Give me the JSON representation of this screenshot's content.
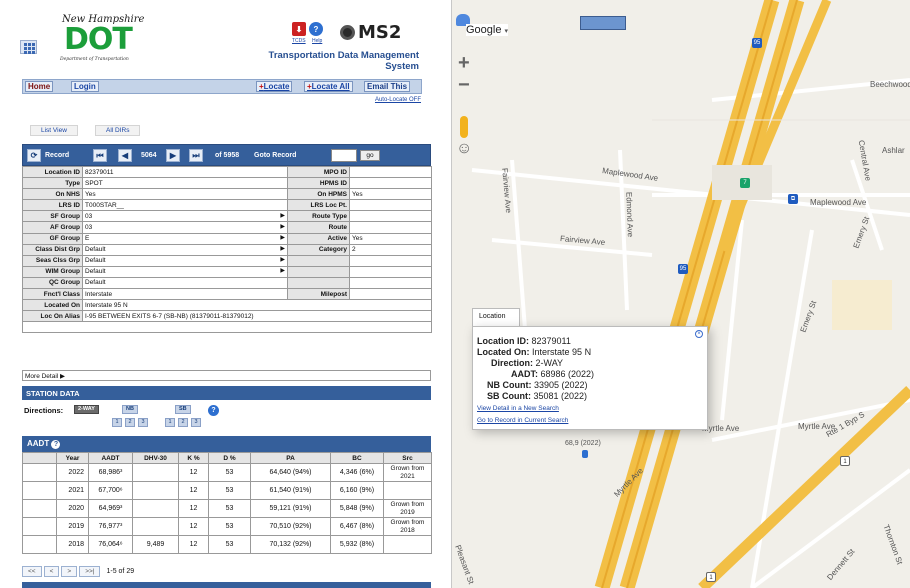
{
  "header": {
    "logo_script": "New Hampshire",
    "logo_main": "DOT",
    "logo_sub": "Department of Transportation",
    "tcds_label": "TCDS",
    "help_label": "Help",
    "brand": "MS2",
    "app_title_line1": "Transportation Data Management",
    "app_title_line2": "System"
  },
  "nav": {
    "home": "Home",
    "login": "Login",
    "locate": "Locate",
    "locate_all": "Locate All",
    "email": "Email This",
    "auto_locate": "Auto-Locate OFF"
  },
  "tabs": {
    "list_view": "List View",
    "all_dirs": "All DIRs"
  },
  "record_bar": {
    "record_label": "Record",
    "current": "5064",
    "of_total": "of 5958",
    "goto_label": "Goto Record",
    "go": "go"
  },
  "detail": {
    "location_id_label": "Location ID",
    "location_id": "82379011",
    "mpo_id_label": "MPO ID",
    "mpo_id": "",
    "type_label": "Type",
    "type": "SPOT",
    "hpms_id_label": "HPMS ID",
    "hpms_id": "",
    "on_nhs_label": "On NHS",
    "on_nhs": "Yes",
    "on_hpms_label": "On HPMS",
    "on_hpms": "Yes",
    "lrs_id_label": "LRS ID",
    "lrs_id": "T000STAR__",
    "lrs_loc_label": "LRS Loc Pt.",
    "lrs_loc": "",
    "sf_group_label": "SF Group",
    "sf_group": "03",
    "route_type_label": "Route Type",
    "route_type": "",
    "af_group_label": "AF Group",
    "af_group": "03",
    "route_label": "Route",
    "route": "",
    "gf_group_label": "GF Group",
    "gf_group": "E",
    "active_label": "Active",
    "active": "Yes",
    "class_dist_label": "Class Dist Grp",
    "class_dist": "Default",
    "category_label": "Category",
    "category": "2",
    "seas_clss_label": "Seas Clss Grp",
    "seas_clss": "Default",
    "wim_group_label": "WIM Group",
    "wim_group": "Default",
    "qc_group_label": "QC Group",
    "qc_group": "Default",
    "fnct_class_label": "Fnct'l Class",
    "fnct_class": "Interstate",
    "milepost_label": "Milepost",
    "milepost": "",
    "located_on_label": "Located On",
    "located_on": "Interstate 95 N",
    "loc_alias_label": "Loc On Alias",
    "loc_alias": "I-95 BETWEEN EXITS 6-7 (SB-NB) (81379011-81379012)",
    "more_detail": "More Detail"
  },
  "station": {
    "title": "STATION DATA",
    "directions_label": "Directions:",
    "dir_2way": "2-WAY",
    "dir_nb": "NB",
    "dir_sb": "SB",
    "lanes": [
      "1",
      "2",
      "3",
      "1",
      "2",
      "3"
    ]
  },
  "aadt": {
    "title": "AADT",
    "columns": [
      "Year",
      "AADT",
      "DHV-30",
      "K %",
      "D %",
      "PA",
      "BC",
      "Src"
    ],
    "rows": [
      [
        "2022",
        "68,986³",
        "",
        "12",
        "53",
        "64,640 (94%)",
        "4,346 (6%)",
        "Grown from 2021"
      ],
      [
        "2021",
        "67,700⁶",
        "",
        "12",
        "53",
        "61,540 (91%)",
        "6,160 (9%)",
        ""
      ],
      [
        "2020",
        "64,969³",
        "",
        "12",
        "53",
        "59,121 (91%)",
        "5,848 (9%)",
        "Grown from 2019"
      ],
      [
        "2019",
        "76,977³",
        "",
        "12",
        "53",
        "70,510 (92%)",
        "6,467 (8%)",
        "Grown from 2018"
      ],
      [
        "2018",
        "76,064⁶",
        "9,489",
        "12",
        "53",
        "70,132 (92%)",
        "5,932 (8%)",
        ""
      ]
    ],
    "pager": {
      "first": "<<",
      "prev": "<",
      "next": ">",
      "last": ">>|",
      "count": "1-5 of 29"
    }
  },
  "map": {
    "provider": "Google",
    "roads": {
      "maplewood1": "Maplewood Ave",
      "maplewood2": "Maplewood Ave",
      "fairview_ave": "Fairview Ave",
      "fairview_ave2": "Fairview Ave",
      "edmond": "Edmond Ave",
      "beechwood": "Beechwood",
      "ashlar": "Ashlar",
      "central": "Central Ave",
      "emery1": "Emery St",
      "emery2": "Emery St",
      "myrtle1": "Myrtle Ave",
      "myrtle2": "Myrtle Ave",
      "myrtle3": "Myrtle Ave",
      "rte1": "Rte 1 Byp S",
      "dennett": "Dennett St",
      "thornton": "Thornton St",
      "pleasant": "Pleasant St"
    },
    "popup": {
      "tab": "Location",
      "location_id_label": "Location ID:",
      "location_id": "82379011",
      "located_on_label": "Located On:",
      "located_on": "Interstate 95 N",
      "direction_label": "Direction:",
      "direction": "2-WAY",
      "aadt_label": "AADT:",
      "aadt": "68986 (2022)",
      "nb_label": "NB Count:",
      "nb": "33905 (2022)",
      "sb_label": "SB Count:",
      "sb": "35081 (2022)",
      "link1": "View Detail in a New Search",
      "link2": "Go to Record in Current Search",
      "marker_label": "68,9 (2022)"
    }
  }
}
